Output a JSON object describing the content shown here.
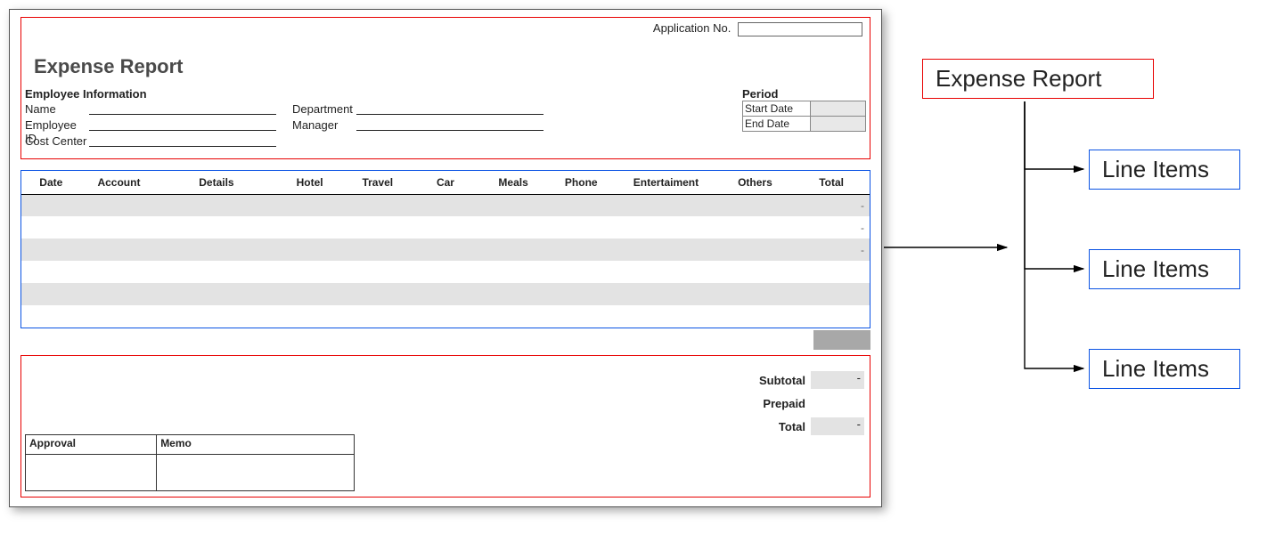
{
  "app_number_label": "Application No.",
  "form_title": "Expense Report",
  "employee_info": {
    "header": "Employee Information",
    "name_label": "Name",
    "employee_id_label": "Employee ID",
    "cost_center_label": "Cost Center",
    "department_label": "Department",
    "manager_label": "Manager"
  },
  "period": {
    "header": "Period",
    "start_label": "Start Date",
    "end_label": "End Date"
  },
  "grid_headers": {
    "date": "Date",
    "account": "Account",
    "details": "Details",
    "hotel": "Hotel",
    "travel": "Travel",
    "car": "Car",
    "meals": "Meals",
    "phone": "Phone",
    "entertainment": "Entertaiment",
    "others": "Others",
    "total": "Total"
  },
  "totals": {
    "subtotal_label": "Subtotal",
    "prepaid_label": "Prepaid",
    "total_label": "Total"
  },
  "approval": {
    "approval_label": "Approval",
    "memo_label": "Memo"
  },
  "annotations": {
    "root": "Expense Report",
    "child": "Line Items"
  }
}
